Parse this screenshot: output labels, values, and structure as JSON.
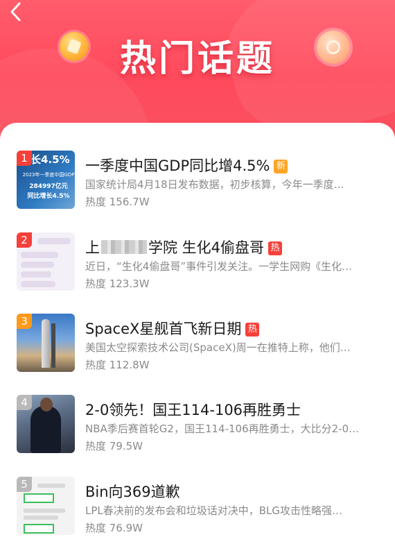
{
  "header": {
    "title": "热门话题",
    "back_icon": "chevron-left-icon",
    "colors": {
      "primary": "#ff4a5c",
      "accent_new": "#ffa424",
      "accent_hot": "#f5413a"
    }
  },
  "topics": [
    {
      "rank": "1",
      "title": "一季度中国GDP同比增4.5%",
      "badge": "新",
      "badge_type": "new",
      "desc": "国家统计局4月18日发布数据，初步核算，今年一季度…",
      "heat": "热度 156.7W",
      "thumb": {
        "big": "长4.5%",
        "small": "2023年一季度中国GDP",
        "mid1": "284997亿元",
        "mid2": "同比增长4.5%"
      }
    },
    {
      "rank": "2",
      "title_prefix": "上",
      "title_suffix": "学院 生化4偷盘哥",
      "badge": "热",
      "badge_type": "hot",
      "desc": "近日，“生化4偷盘哥”事件引发关注。一学生网购《生化…",
      "heat": "热度 123.3W"
    },
    {
      "rank": "3",
      "title": "SpaceX星舰首飞新日期",
      "badge": "热",
      "badge_type": "hot",
      "desc": "美国太空探索技术公司(SpaceX)周一在推特上称，他们…",
      "heat": "热度 112.8W"
    },
    {
      "rank": "4",
      "title": "2-0领先！国王114-106再胜勇士",
      "desc": "NBA季后赛首轮G2，国王114-106再胜勇士，大比分2-0…",
      "heat": "热度 79.5W"
    },
    {
      "rank": "5",
      "title": "Bin向369道歉",
      "desc": "LPL春决前的发布会和垃圾话对决中，BLG攻击性略强…",
      "heat": "热度 76.9W"
    }
  ]
}
